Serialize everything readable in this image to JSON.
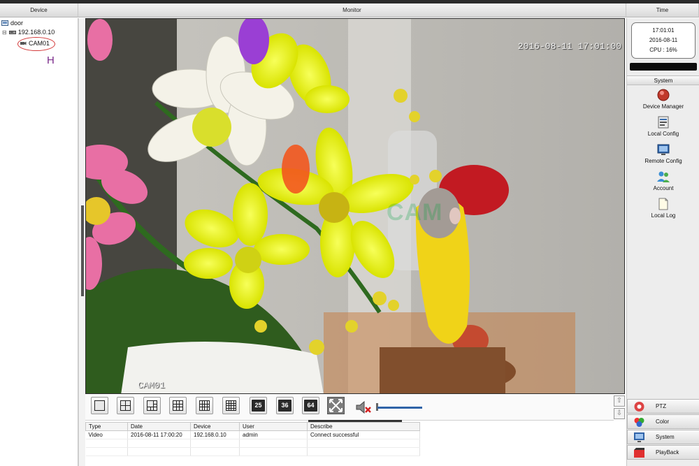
{
  "header": {
    "device": "Device",
    "monitor": "Monitor",
    "time": "Time"
  },
  "device_tree": {
    "group": "door",
    "device_ip": "192.168.0.10",
    "camera": "CAM01",
    "annotation_letter": "H"
  },
  "video": {
    "osd_datetime": "2016-08-11 17:01:00",
    "osd_camera": "CAM01",
    "watermark": "CAM"
  },
  "toolbar": {
    "layouts": [
      {
        "name": "layout-1",
        "grid": 1
      },
      {
        "name": "layout-4",
        "grid": 2
      },
      {
        "name": "layout-6",
        "grid": 3
      },
      {
        "name": "layout-8",
        "grid": 3
      },
      {
        "name": "layout-9",
        "grid": 3
      },
      {
        "name": "layout-16",
        "grid": 4
      }
    ],
    "numbered": [
      "25",
      "36",
      "64"
    ],
    "volume_level": 0.05
  },
  "log": {
    "columns": [
      "Type",
      "Date",
      "Device",
      "User",
      "Describe"
    ],
    "rows": [
      [
        "Video",
        "2016-08-11 17:00:20",
        "192.168.0.10",
        "admin",
        "Connect successful"
      ]
    ]
  },
  "clock": {
    "time": "17:01:01",
    "date": "2016-08-11",
    "cpu": "CPU : 16%"
  },
  "system_menu": {
    "header": "System",
    "items": [
      {
        "label": "Device Manager",
        "icon": "device-manager-icon"
      },
      {
        "label": "Local Config",
        "icon": "local-config-icon"
      },
      {
        "label": "Remote Config",
        "icon": "remote-config-icon"
      },
      {
        "label": "Account",
        "icon": "account-icon"
      },
      {
        "label": "Local Log",
        "icon": "local-log-icon"
      }
    ]
  },
  "bottom_tabs": {
    "ptz": "PTZ",
    "color": "Color",
    "system": "System",
    "playback": "PlayBack"
  },
  "colors": {
    "accent_blue": "#2f63a8",
    "alarm_red": "#d43a3a"
  }
}
